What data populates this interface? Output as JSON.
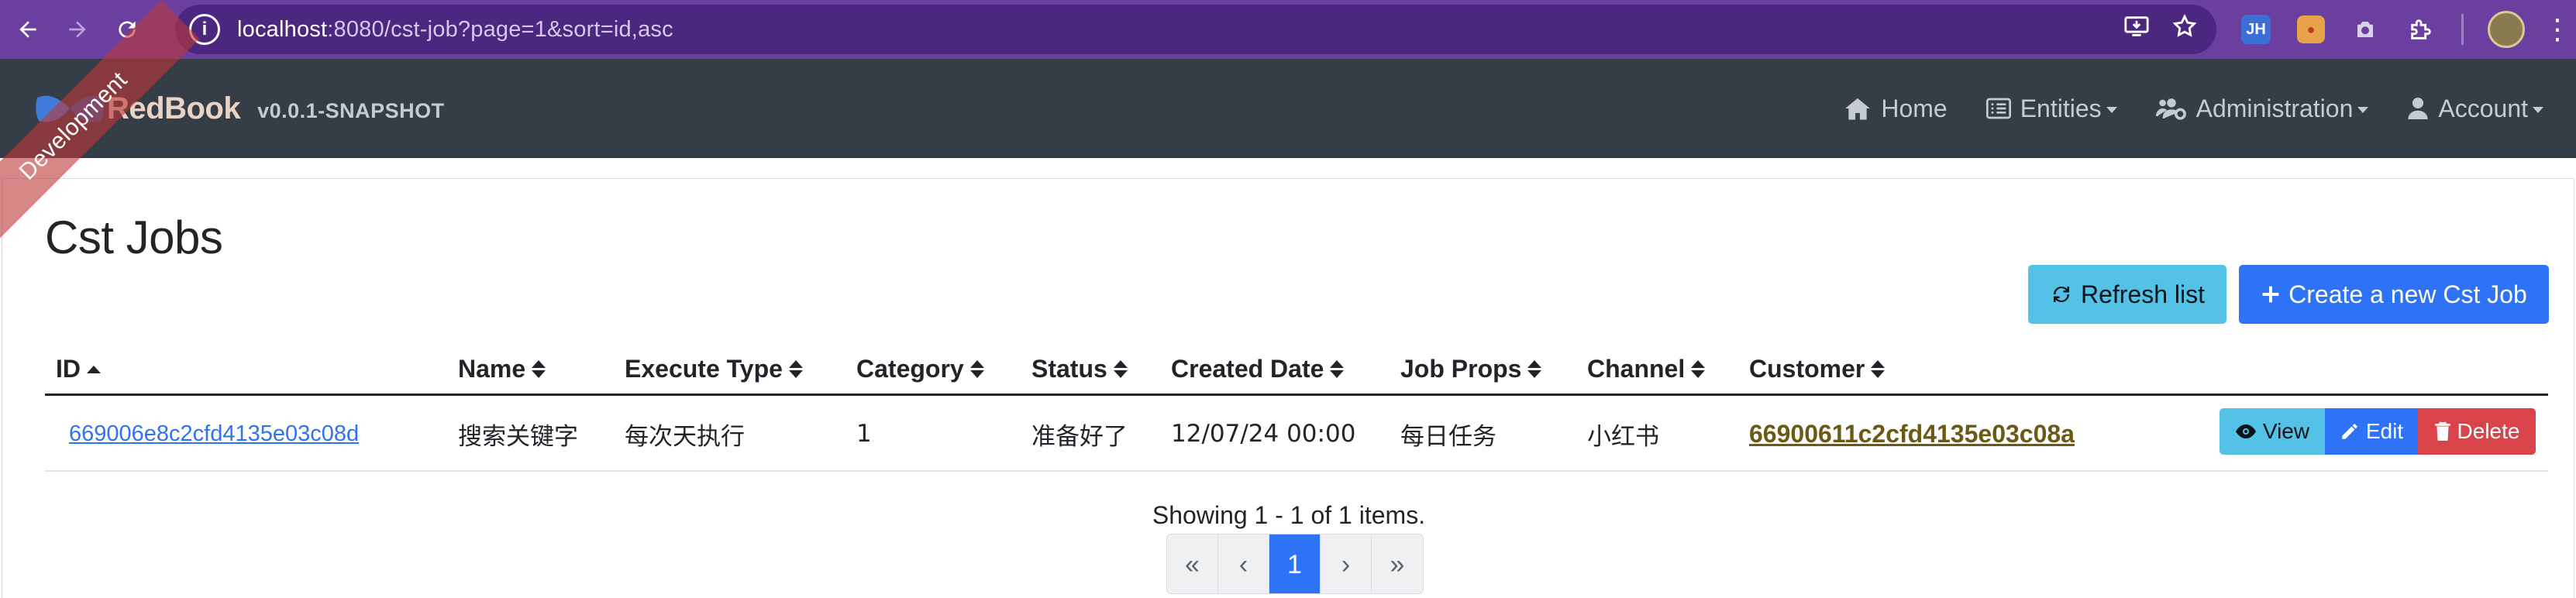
{
  "browser": {
    "url_host": "localhost",
    "url_path": ":8080/cst-job?page=1&sort=id,asc",
    "extension_jh": "JH"
  },
  "navbar": {
    "brand_name": "RedBook",
    "version": "v0.0.1-SNAPSHOT",
    "items": [
      {
        "label": "Home",
        "icon": "home-icon"
      },
      {
        "label": "Entities",
        "icon": "list-icon"
      },
      {
        "label": "Administration",
        "icon": "users-cog-icon"
      },
      {
        "label": "Account",
        "icon": "user-icon"
      }
    ]
  },
  "ribbon": "Development",
  "page": {
    "title": "Cst Jobs",
    "refresh_label": "Refresh list",
    "create_label": "Create a new Cst Job"
  },
  "table": {
    "columns": [
      "ID",
      "Name",
      "Execute Type",
      "Category",
      "Status",
      "Created Date",
      "Job Props",
      "Channel",
      "Customer"
    ],
    "rows": [
      {
        "id": "669006e8c2cfd4135e03c08d",
        "name": "搜索关键字",
        "execute_type": "每次天执行",
        "category": "1",
        "status": "准备好了",
        "created_date": "12/07/24 00:00",
        "job_props": "每日任务",
        "channel": "小红书",
        "customer": "66900611c2cfd4135e03c08a"
      }
    ],
    "actions": {
      "view": "View",
      "edit": "Edit",
      "delete": "Delete"
    }
  },
  "pagination": {
    "summary": "Showing 1 - 1 of 1 items.",
    "first": "«",
    "prev": "‹",
    "current": "1",
    "next": "›",
    "last": "»"
  },
  "colors": {
    "browser_frame": "#6a3fa0",
    "navbar": "#353d47",
    "primary": "#2e73f5",
    "info": "#54c2e6",
    "danger": "#d9434a"
  }
}
